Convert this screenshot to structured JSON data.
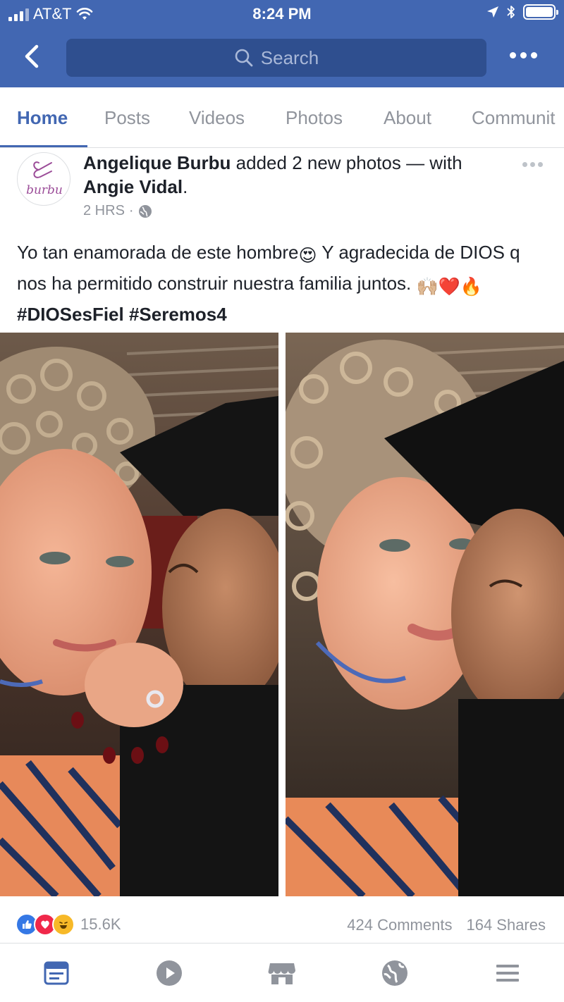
{
  "status_bar": {
    "carrier": "AT&T",
    "time": "8:24 PM"
  },
  "search": {
    "placeholder": "Search"
  },
  "tabs": [
    {
      "label": "Home",
      "active": true
    },
    {
      "label": "Posts",
      "active": false
    },
    {
      "label": "Videos",
      "active": false
    },
    {
      "label": "Photos",
      "active": false
    },
    {
      "label": "About",
      "active": false
    },
    {
      "label": "Communit",
      "active": false
    }
  ],
  "post": {
    "avatar_text": "burbu",
    "author": "Angelique Burbu",
    "action": "added 2 new photos — with",
    "tagged": "Angie Vidal",
    "tagged_suffix": ".",
    "time": "2 HRS",
    "meta_sep": "·",
    "text_line1": "Yo tan enamorada de este hombre",
    "text_line1b": " Y agradecida de DIOS q nos ha permitido construir nuestra familia juntos.",
    "emoji_heart_eyes": "😍",
    "emoji_end": "🙌🏼❤️🔥",
    "hashtags": [
      "#DIOSesFiel",
      "#Seremos4"
    ],
    "photos": [
      {
        "name": "photo-1"
      },
      {
        "name": "photo-2"
      }
    ],
    "reactions_count": "15.6K",
    "comments": "424 Comments",
    "shares": "164 Shares"
  },
  "colors": {
    "brand_blue": "#4267b2",
    "search_bg": "#2f4f8f",
    "muted_text": "#90949c",
    "like_blue": "#3578e5",
    "love_red": "#f0284a",
    "haha_yellow": "#f7b928"
  },
  "bottom_nav": [
    {
      "icon": "news-feed-icon",
      "active": true
    },
    {
      "icon": "video-play-icon",
      "active": false
    },
    {
      "icon": "marketplace-store-icon",
      "active": false
    },
    {
      "icon": "globe-notifications-icon",
      "active": false
    },
    {
      "icon": "menu-hamburger-icon",
      "active": false
    }
  ]
}
